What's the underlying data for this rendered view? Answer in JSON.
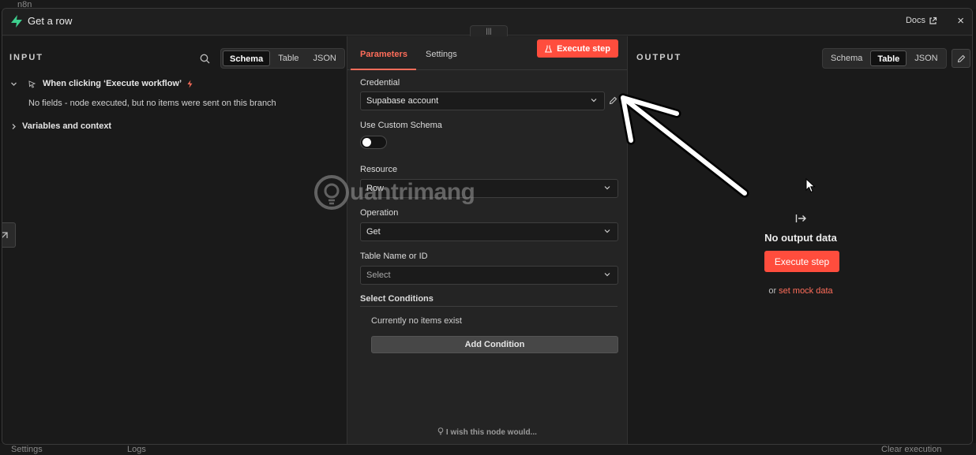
{
  "window": {
    "title": "Get a row",
    "docs_label": "Docs",
    "close_label": "×"
  },
  "background": {
    "app_name": "n8n",
    "sidebar_settings": "Settings",
    "logs": "Logs",
    "clear_execution": "Clear execution"
  },
  "input_panel": {
    "label": "INPUT",
    "view_tabs": [
      "Schema",
      "Table",
      "JSON"
    ],
    "active_tab": "Schema",
    "trigger_node": "When clicking ‘Execute workflow’",
    "no_fields_message": "No fields - node executed, but no items were sent on this branch",
    "variables_label": "Variables and context"
  },
  "parameters_panel": {
    "tabs": [
      "Parameters",
      "Settings"
    ],
    "active_tab": "Parameters",
    "execute_button": "Execute step",
    "credential": {
      "label": "Credential",
      "value": "Supabase account"
    },
    "custom_schema": {
      "label": "Use Custom Schema",
      "enabled": false
    },
    "resource": {
      "label": "Resource",
      "value": "Row"
    },
    "operation": {
      "label": "Operation",
      "value": "Get"
    },
    "table": {
      "label": "Table Name or ID",
      "placeholder": "Select"
    },
    "conditions": {
      "label": "Select Conditions",
      "empty_message": "Currently no items exist",
      "add_button": "Add Condition"
    },
    "feedback_link": "I wish this node would..."
  },
  "output_panel": {
    "label": "OUTPUT",
    "view_tabs": [
      "Schema",
      "Table",
      "JSON"
    ],
    "active_tab": "Table",
    "empty_title": "No output data",
    "execute_button": "Execute step",
    "mock_prefix": "or",
    "mock_link": "set mock data"
  },
  "watermark": {
    "text": "uantrimang"
  },
  "colors": {
    "accent": "#ff6d5a",
    "execute_bg": "#ff4d3d",
    "panel_bg": "#1f1f1f",
    "params_bg": "#242424"
  }
}
